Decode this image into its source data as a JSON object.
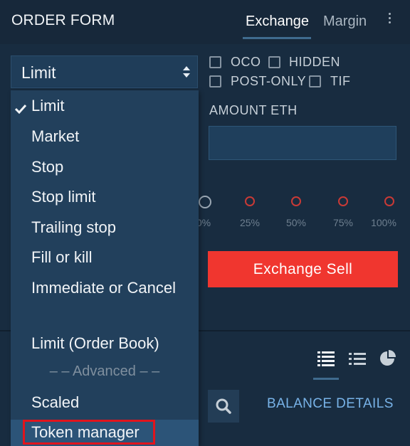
{
  "header": {
    "title": "ORDER FORM",
    "tabs": [
      {
        "label": "Exchange",
        "active": true
      },
      {
        "label": "Margin",
        "active": false
      }
    ]
  },
  "order_type": {
    "selected": "Limit",
    "options": [
      {
        "label": "Limit",
        "checked": true
      },
      {
        "label": "Market"
      },
      {
        "label": "Stop"
      },
      {
        "label": "Stop limit"
      },
      {
        "label": "Trailing stop"
      },
      {
        "label": "Fill or kill"
      },
      {
        "label": "Immediate or Cancel"
      },
      {
        "label": "Limit (Order Book)"
      },
      {
        "label": "Scaled"
      },
      {
        "label": "Token manager",
        "highlighted": true
      }
    ],
    "advanced_separator": "– – Advanced – –"
  },
  "options": {
    "oco": "OCO",
    "hidden": "HIDDEN",
    "post_only": "POST-ONLY",
    "tif": "TIF"
  },
  "amount": {
    "label": "AMOUNT ETH",
    "value": ""
  },
  "slider": {
    "percents": [
      "0%",
      "25%",
      "50%",
      "75%",
      "100%"
    ]
  },
  "sell_button": "Exchange Sell",
  "balance_details": "BALANCE DETAILS",
  "colors": {
    "sell": "#f0362f",
    "highlight_border": "#e1141c",
    "link": "#78b3e8"
  }
}
